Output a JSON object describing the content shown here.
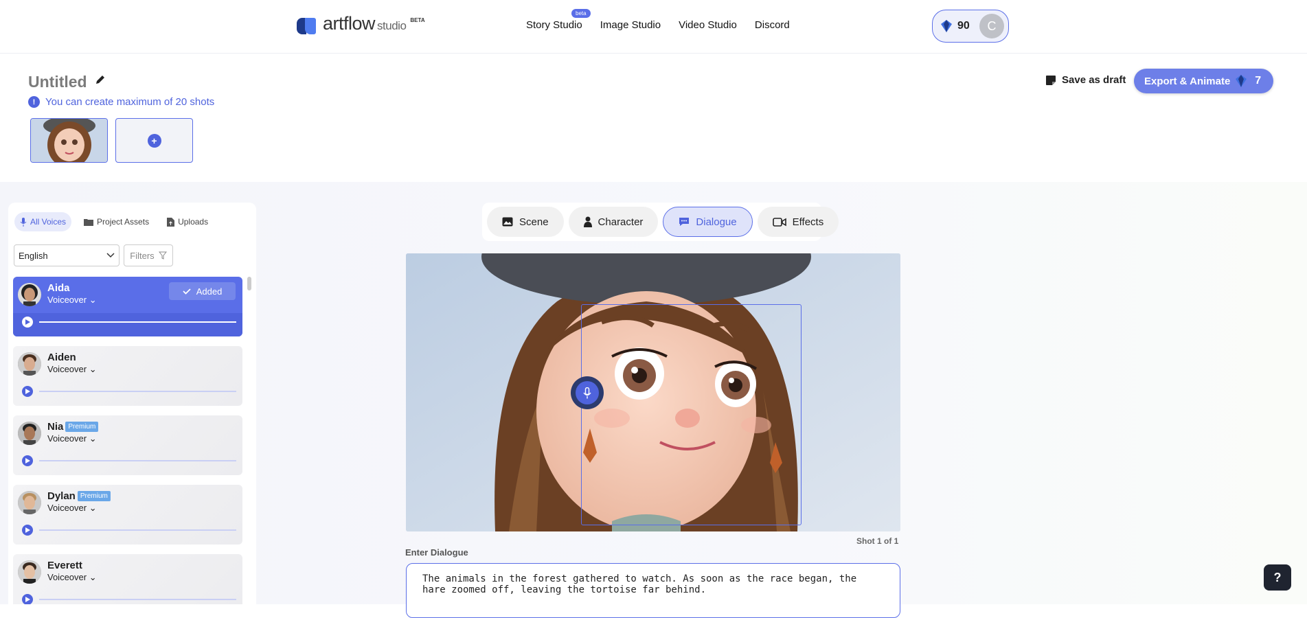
{
  "app": {
    "brand": "artflow",
    "brand_sub": "studio",
    "brand_badge": "BETA"
  },
  "nav": {
    "items": [
      {
        "label": "Story Studio",
        "badge": "beta"
      },
      {
        "label": "Image Studio"
      },
      {
        "label": "Video Studio"
      },
      {
        "label": "Discord"
      }
    ]
  },
  "account": {
    "credits": "90",
    "avatar_initial": "C"
  },
  "project": {
    "title": "Untitled",
    "notice": "You can create maximum of 20 shots",
    "save_draft_label": "Save as draft",
    "export_label": "Export & Animate",
    "export_cost": "7"
  },
  "voices_panel": {
    "tabs": [
      "All Voices",
      "Project Assets",
      "Uploads"
    ],
    "language": "English",
    "filters_label": "Filters",
    "voices": [
      {
        "name": "Aida",
        "type": "Voiceover",
        "added_label": "Added",
        "premium": ""
      },
      {
        "name": "Aiden",
        "type": "Voiceover",
        "premium": ""
      },
      {
        "name": "Nia",
        "type": "Voiceover",
        "premium": "Premium"
      },
      {
        "name": "Dylan",
        "type": "Voiceover",
        "premium": "Premium"
      },
      {
        "name": "Everett",
        "type": "Voiceover",
        "premium": ""
      }
    ]
  },
  "editor": {
    "tabs": [
      "Scene",
      "Character",
      "Dialogue",
      "Effects"
    ],
    "active_tab": "Dialogue",
    "shot_counter": "Shot 1 of 1",
    "dialogue_label": "Enter Dialogue",
    "dialogue_text_1": "The animals in the forest gathered to watch. As soon as the race began, the",
    "dialogue_text_2": "hare zoomed off, leaving the tortoise far behind."
  },
  "help_label": "?",
  "colors": {
    "accent": "#5a6ee8",
    "accent_dark": "#4f63dd"
  }
}
